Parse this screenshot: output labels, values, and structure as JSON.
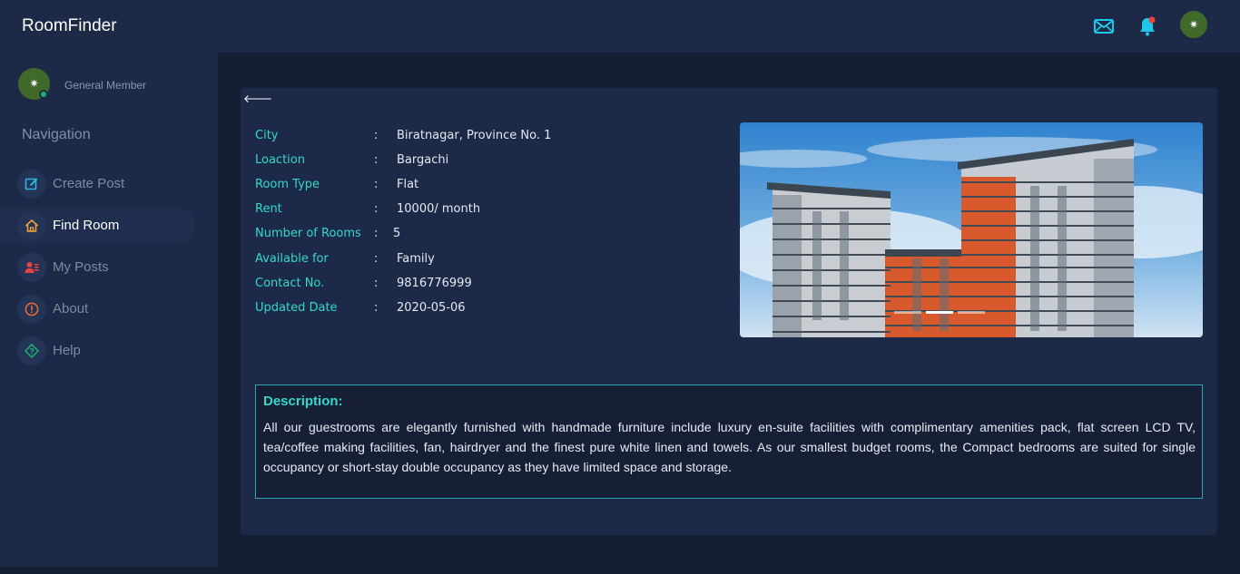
{
  "header": {
    "brand": "RoomFinder",
    "icons": [
      "mail-icon",
      "bell-icon"
    ],
    "avatar_glyph": "✷"
  },
  "sidebar": {
    "avatar_glyph": "✷",
    "member_label": "General Member",
    "nav_title": "Navigation",
    "items": [
      {
        "label": "Create Post",
        "icon": "edit-icon",
        "color": "#2bb6e0"
      },
      {
        "label": "Find Room",
        "icon": "home-icon",
        "color": "#f0a33a",
        "active": true
      },
      {
        "label": "My Posts",
        "icon": "users-icon",
        "color": "#e8433d"
      },
      {
        "label": "About",
        "icon": "info-icon",
        "color": "#e86a2f"
      },
      {
        "label": "Help",
        "icon": "help-icon",
        "color": "#1bb071"
      }
    ]
  },
  "room": {
    "back_glyph": "🡐",
    "separator": ":",
    "details": [
      {
        "label": "City",
        "value": "Biratnagar, Province No. 1"
      },
      {
        "label": "Loaction",
        "value": "Bargachi"
      },
      {
        "label": "Room Type",
        "value": "Flat"
      },
      {
        "label": "Rent",
        "value": "10000/ month"
      },
      {
        "label": "Number of Rooms",
        "value": "5"
      },
      {
        "label": "Available for",
        "value": "Family"
      },
      {
        "label": "Contact No.",
        "value": "9816776999"
      },
      {
        "label": "Updated Date",
        "value": "2020-05-06"
      }
    ],
    "carousel": {
      "slides": 3,
      "active_slide": 1
    }
  },
  "description": {
    "title": "Description:",
    "text": "All our guestrooms are elegantly furnished with handmade furniture include luxury en-suite facilities with complimentary amenities pack, flat screen LCD TV, tea/coffee making facilities, fan, hairdryer and the finest pure white linen and towels. As our smallest budget rooms, the Compact bedrooms are suited for single occupancy or short-stay double occupancy as they have limited space and storage."
  },
  "colors": {
    "accent": "#34d8c8",
    "topbar_icons": "#1ec8e8",
    "notification_dot": "#e8433d",
    "background": "#141f33",
    "panel": "#1c2a48"
  }
}
